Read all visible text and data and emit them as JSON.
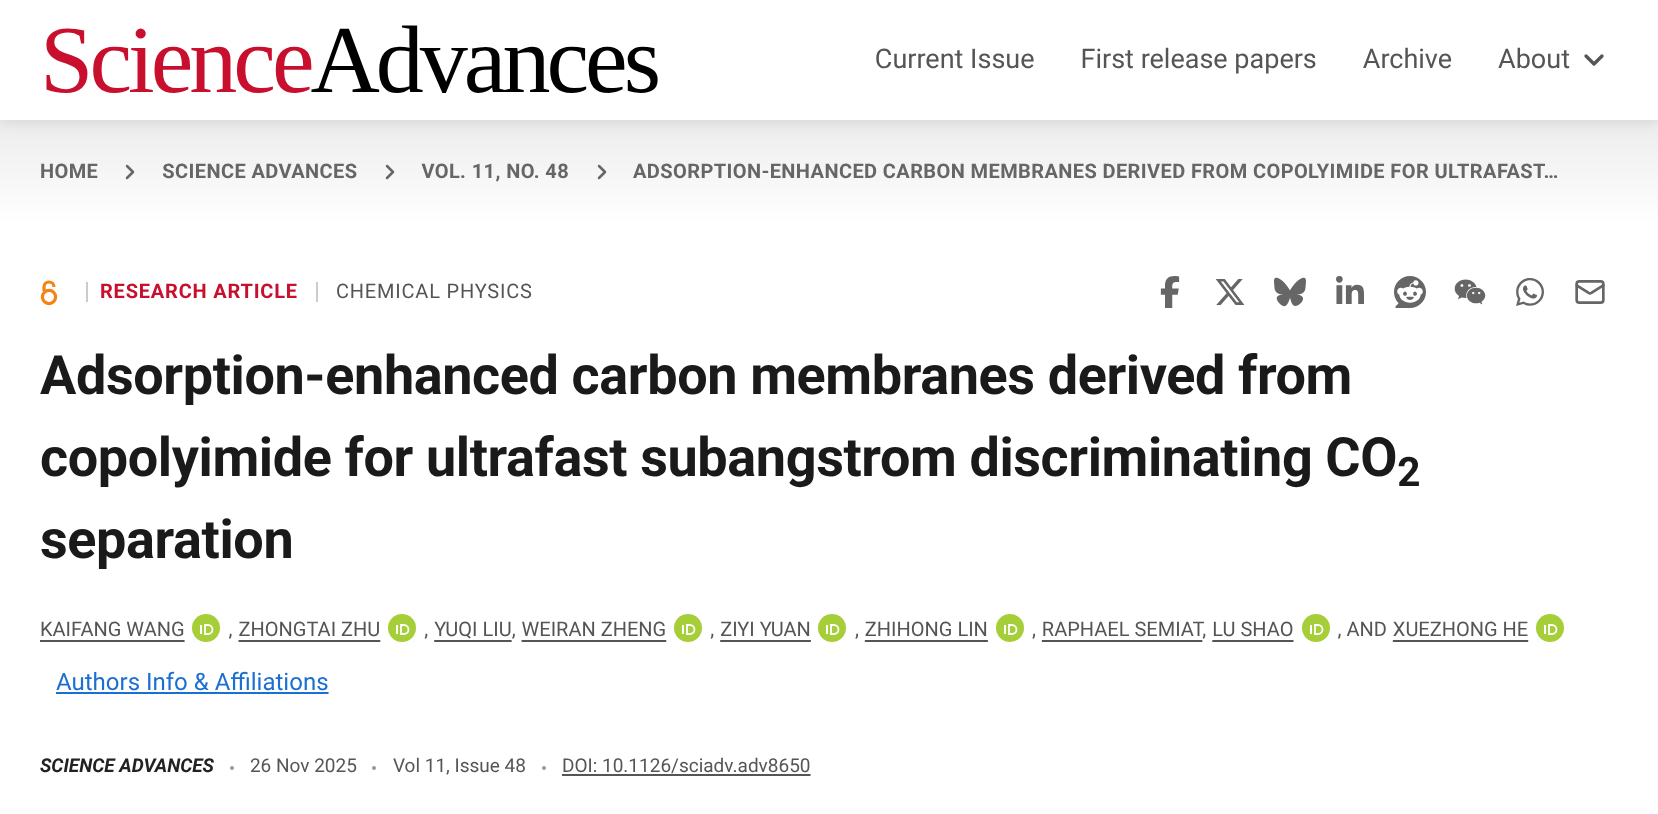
{
  "logo": {
    "part_1": "Science",
    "part_2": "Advances"
  },
  "nav": [
    {
      "label": "Current Issue",
      "dropdown": false
    },
    {
      "label": "First release papers",
      "dropdown": false
    },
    {
      "label": "Archive",
      "dropdown": false
    },
    {
      "label": "About",
      "dropdown": true
    }
  ],
  "breadcrumbs": [
    "HOME",
    "SCIENCE ADVANCES",
    "VOL. 11, NO. 48",
    "ADSORPTION-ENHANCED CARBON MEMBRANES DERIVED FROM COPOLYIMIDE FOR ULTRAFAST…"
  ],
  "article": {
    "open_access": true,
    "type": "RESEARCH ARTICLE",
    "subject": "CHEMICAL PHYSICS",
    "title": "Adsorption-enhanced carbon membranes derived from copolyimide for ultrafast subangstrom discriminating CO$_{2}$ separation",
    "authors": [
      {
        "name": "KAIFANG WANG",
        "orcid": true,
        "separator": ","
      },
      {
        "name": "ZHONGTAI ZHU",
        "orcid": true,
        "separator": ","
      },
      {
        "name": "YUQI LIU",
        "orcid": false,
        "separator": ","
      },
      {
        "name": "WEIRAN ZHENG",
        "orcid": true,
        "separator": ","
      },
      {
        "name": "ZIYI YUAN",
        "orcid": true,
        "separator": ","
      },
      {
        "name": "ZHIHONG LIN",
        "orcid": true,
        "separator": ","
      },
      {
        "name": "RAPHAEL SEMIAT",
        "orcid": false,
        "separator": ","
      },
      {
        "name": "LU SHAO",
        "orcid": true,
        "separator": ", AND"
      },
      {
        "name": "XUEZHONG HE",
        "orcid": true
      }
    ],
    "affiliations_link": "Authors Info & Affiliations",
    "journal": "SCIENCE ADVANCES",
    "date": "26 Nov 2025",
    "volume": "Vol 11, Issue 48",
    "doi": "DOI: 10.1126/sciadv.adv8650"
  }
}
